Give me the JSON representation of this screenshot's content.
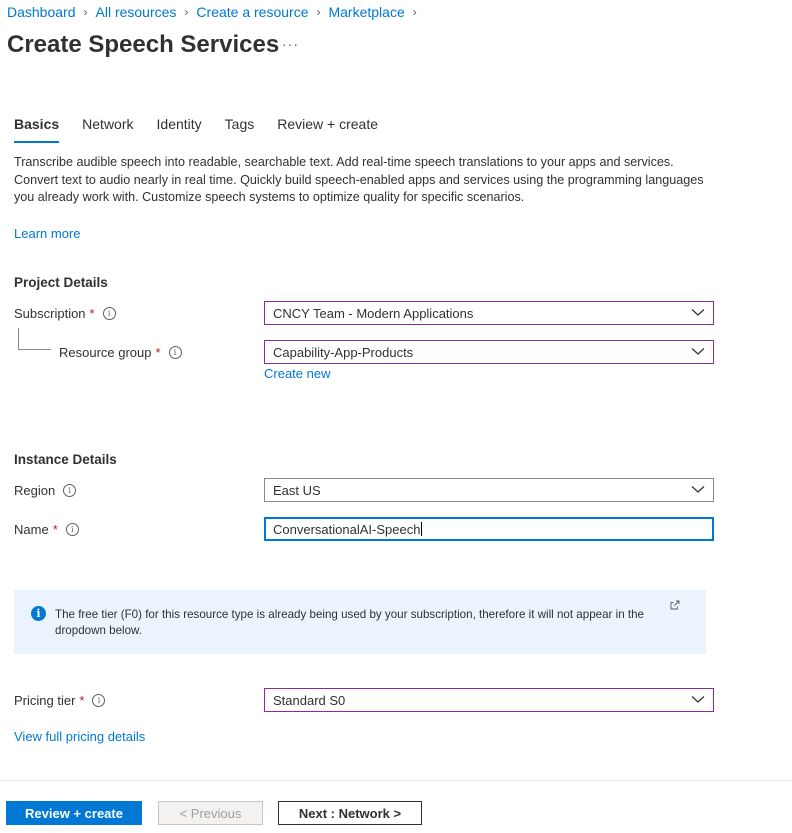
{
  "breadcrumb": [
    "Dashboard",
    "All resources",
    "Create a resource",
    "Marketplace"
  ],
  "page": {
    "title": "Create Speech Services",
    "more": "···"
  },
  "tabs": [
    {
      "label": "Basics",
      "active": true
    },
    {
      "label": "Network"
    },
    {
      "label": "Identity"
    },
    {
      "label": "Tags"
    },
    {
      "label": "Review + create"
    }
  ],
  "intro": {
    "description": "Transcribe audible speech into readable, searchable text. Add real-time speech translations to your apps and services. Convert text to audio nearly in real time. Quickly build speech-enabled apps and services using the programming languages you already work with. Customize speech systems to optimize quality for specific scenarios.",
    "learn_more": "Learn more"
  },
  "project_details": {
    "title": "Project Details",
    "subscription_label": "Subscription",
    "subscription_value": "CNCY Team - Modern Applications",
    "resource_group_label": "Resource group",
    "resource_group_value": "Capability-App-Products",
    "create_new": "Create new"
  },
  "instance_details": {
    "title": "Instance Details",
    "region_label": "Region",
    "region_value": "East US",
    "name_label": "Name",
    "name_value": "ConversationalAI-Speech"
  },
  "info_message": "The free tier (F0) for this resource type is already being used by your subscription, therefore it will not appear in the dropdown below.",
  "pricing": {
    "label": "Pricing tier",
    "value": "Standard S0",
    "view_details": "View full pricing details"
  },
  "footer": {
    "review_create": "Review + create",
    "previous": "< Previous",
    "next": "Next : Network >"
  },
  "required_marker": "*",
  "info_glyph": "i",
  "colors": {
    "accent": "#0078d4",
    "required": "#a4262c",
    "dropdown_border": "#8a2a9c",
    "info_background": "#ebf3fc"
  }
}
